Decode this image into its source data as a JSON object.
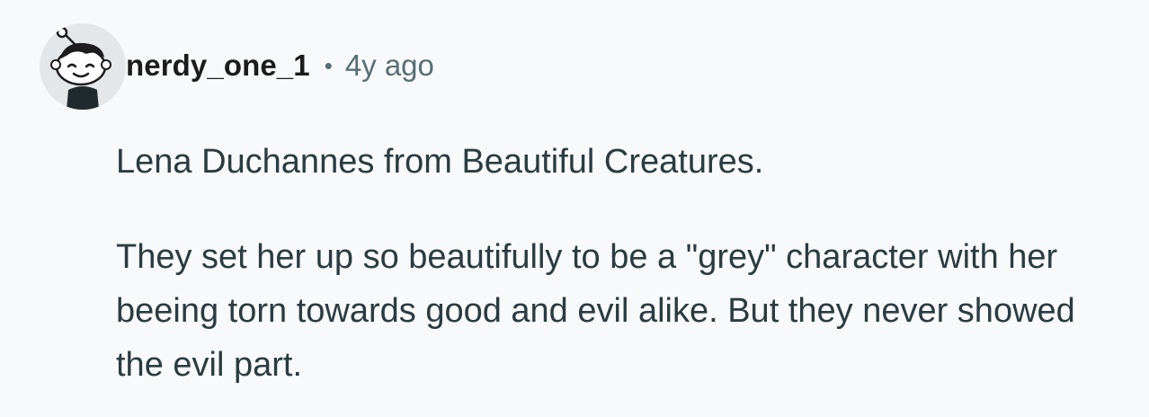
{
  "comment": {
    "author": "nerdy_one_1",
    "separator": "•",
    "time_ago": "4y ago",
    "avatar_icon": "snoo-avatar-icon",
    "paragraphs": [
      "Lena Duchannes from Beautiful Creatures.",
      "They set her up so beautifully to be a \"grey\" character with her beeing torn towards good and evil alike. But they never showed the evil part."
    ]
  },
  "colors": {
    "background": "#f8f9fa",
    "username": "#1c1c1c",
    "meta": "#576f76",
    "body_text": "#2a3c42"
  }
}
